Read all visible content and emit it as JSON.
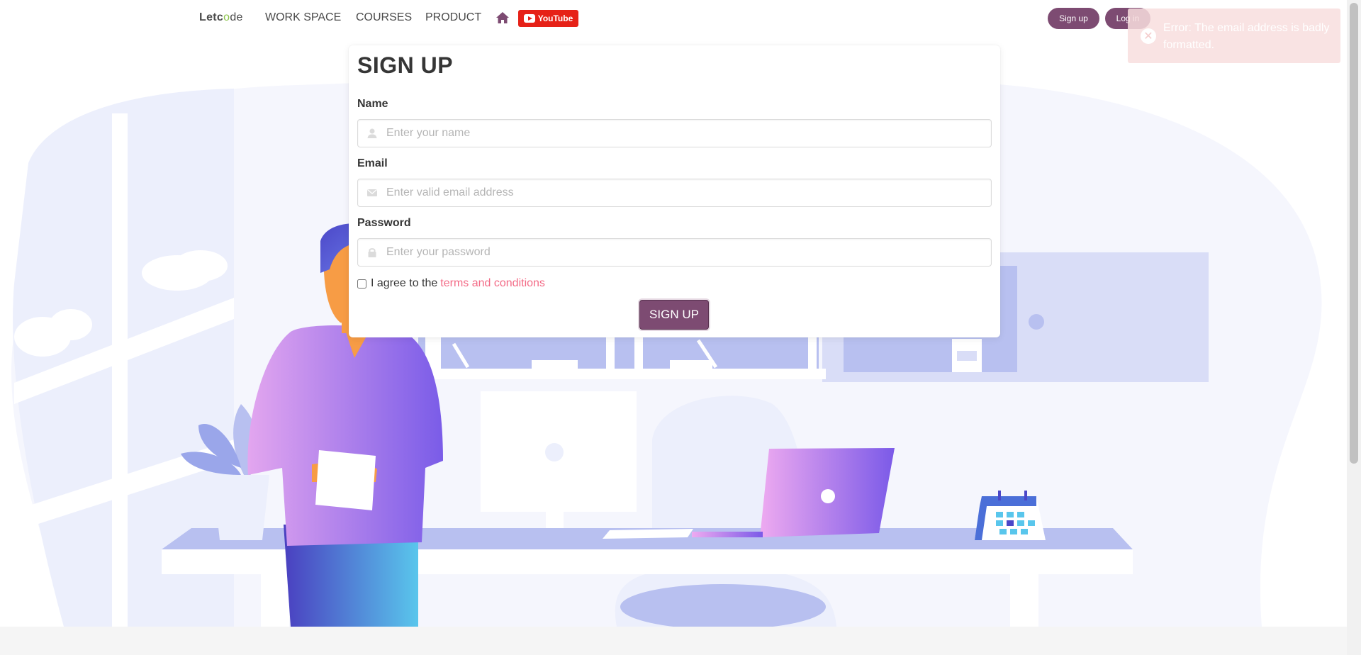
{
  "navbar": {
    "logo": {
      "part1": "Letc",
      "part2": "o",
      "part3": "de"
    },
    "links": [
      "WORK SPACE",
      "COURSES",
      "PRODUCT"
    ],
    "home_icon": "home-icon",
    "youtube_label": "YouTube",
    "signup_label": "Sign up",
    "login_label": "Log in"
  },
  "toast": {
    "message": "Error: The email address is badly formatted.",
    "icon": "close-circle-icon"
  },
  "form": {
    "title": "SIGN UP",
    "name_label": "Name",
    "name_placeholder": "Enter your name",
    "name_value": "",
    "email_label": "Email",
    "email_placeholder": "Enter valid email address",
    "email_value": "",
    "password_label": "Password",
    "password_placeholder": "Enter your password",
    "password_value": "",
    "terms_prefix": "I agree to the",
    "terms_link": "terms and conditions",
    "terms_checked": false,
    "submit_label": "SIGN UP"
  },
  "colors": {
    "brand": "#7d4b72",
    "link": "#f14668",
    "youtube": "#e62117",
    "toast_bg": "#f8dede",
    "illustration_light": "#eef0fc",
    "illustration_mid": "#b8c0f0"
  }
}
